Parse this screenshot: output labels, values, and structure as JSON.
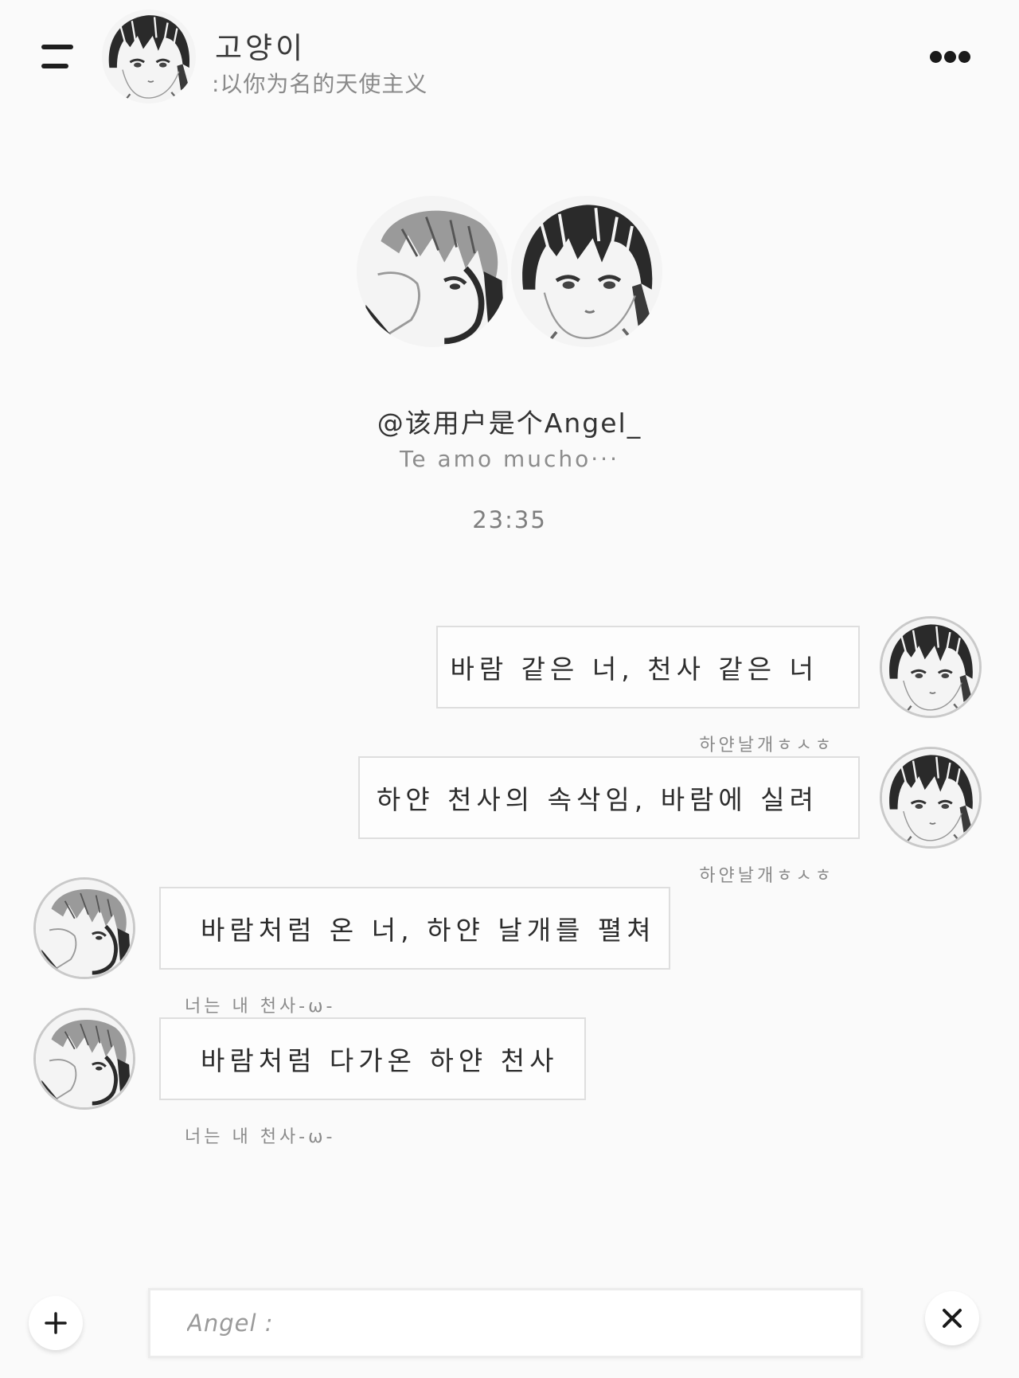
{
  "header": {
    "contact_name": "고양이",
    "contact_subtitle": ":以你为名的天使主义",
    "menu_icon": "menu-icon",
    "more_icon": "more-dots-icon"
  },
  "profile": {
    "username": "@该用户是个Angel_",
    "status": "Te amo mucho···",
    "timestamp": "23:35"
  },
  "messages": [
    {
      "side": "outgoing",
      "text": "바람 같은 너, 천사 같은 너",
      "caption": "하얀날개ㅎㅅㅎ"
    },
    {
      "side": "outgoing",
      "text": "하얀 천사의 속삭임, 바람에 실려",
      "caption": "하얀날개ㅎㅅㅎ"
    },
    {
      "side": "incoming",
      "text": "바람처럼 온 너, 하얀 날개를 펼쳐",
      "caption": "너는 내 천사-ω-"
    },
    {
      "side": "incoming",
      "text": "바람처럼 다가온 하얀 천사",
      "caption": "너는 내 천사-ω-"
    }
  ],
  "composer": {
    "placeholder": "Angel :",
    "value": "",
    "plus_icon": "plus-icon",
    "close_icon": "close-icon"
  },
  "colors": {
    "background": "#fafafa",
    "bubble_border": "#dedede",
    "text": "#2c2c2c",
    "muted": "#8a8a8a"
  }
}
